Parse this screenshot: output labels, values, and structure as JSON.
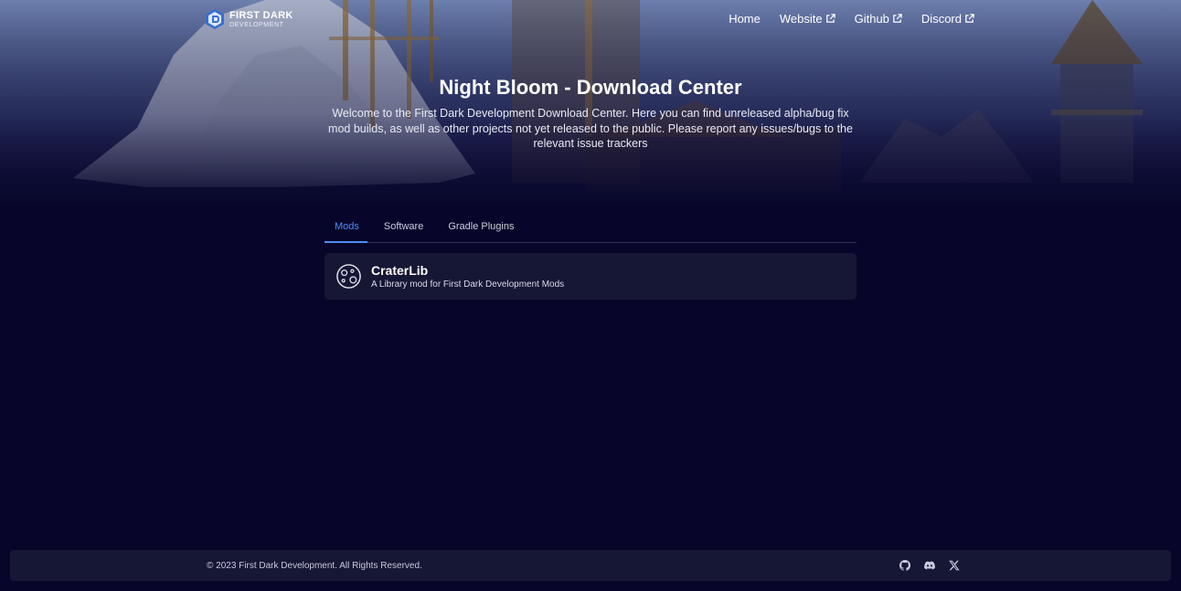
{
  "brand": {
    "line1": "FIRST DARK",
    "line2": "DEVELOPMENT"
  },
  "nav": {
    "home": "Home",
    "website": "Website",
    "github": "Github",
    "discord": "Discord"
  },
  "hero": {
    "title": "Night Bloom - Download Center",
    "description": "Welcome to the First Dark Development Download Center. Here you can find unreleased alpha/bug fix mod builds, as well as other projects not yet released to the public. Please report any issues/bugs to the relevant issue trackers"
  },
  "tabs": [
    {
      "label": "Mods",
      "active": true
    },
    {
      "label": "Software",
      "active": false
    },
    {
      "label": "Gradle Plugins",
      "active": false
    }
  ],
  "projects": [
    {
      "name": "CraterLib",
      "description": "A Library mod for First Dark Development Mods",
      "icon": "crater-icon"
    }
  ],
  "footer": {
    "copyright": "© 2023 First Dark Development. All Rights Reserved.",
    "icons": [
      "github-icon",
      "discord-icon",
      "x-icon"
    ]
  },
  "colors": {
    "background": "#07062a",
    "accent": "#4e8cf4",
    "card": "#161635"
  }
}
